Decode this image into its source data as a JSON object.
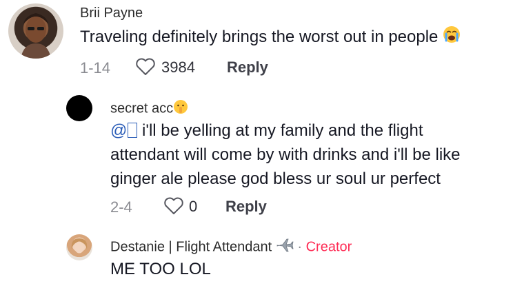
{
  "comments": [
    {
      "author": "Brii Payne",
      "text": "Traveling definitely brings the worst out in people",
      "emoji": "loudly-crying-face",
      "date": "1-14",
      "likes": "3984",
      "reply_label": "Reply"
    },
    {
      "author": "secret acc",
      "author_emoji": "shushing-face",
      "mention": "@",
      "text_line1": " i'll be yelling at my family and the flight",
      "text_line2": "attendant will come by with drinks and i'll be like",
      "text_line3": "ginger ale please god bless ur soul ur perfect",
      "date": "2-4",
      "likes": "0",
      "reply_label": "Reply"
    },
    {
      "author": "Destanie | Flight Attendant",
      "author_emoji": "airplane",
      "separator": "·",
      "badge": "Creator",
      "text": "ME TOO LOL"
    }
  ],
  "colors": {
    "creator": "#fe2c55",
    "mention": "#2b5db8",
    "meta": "#8a8b91"
  }
}
